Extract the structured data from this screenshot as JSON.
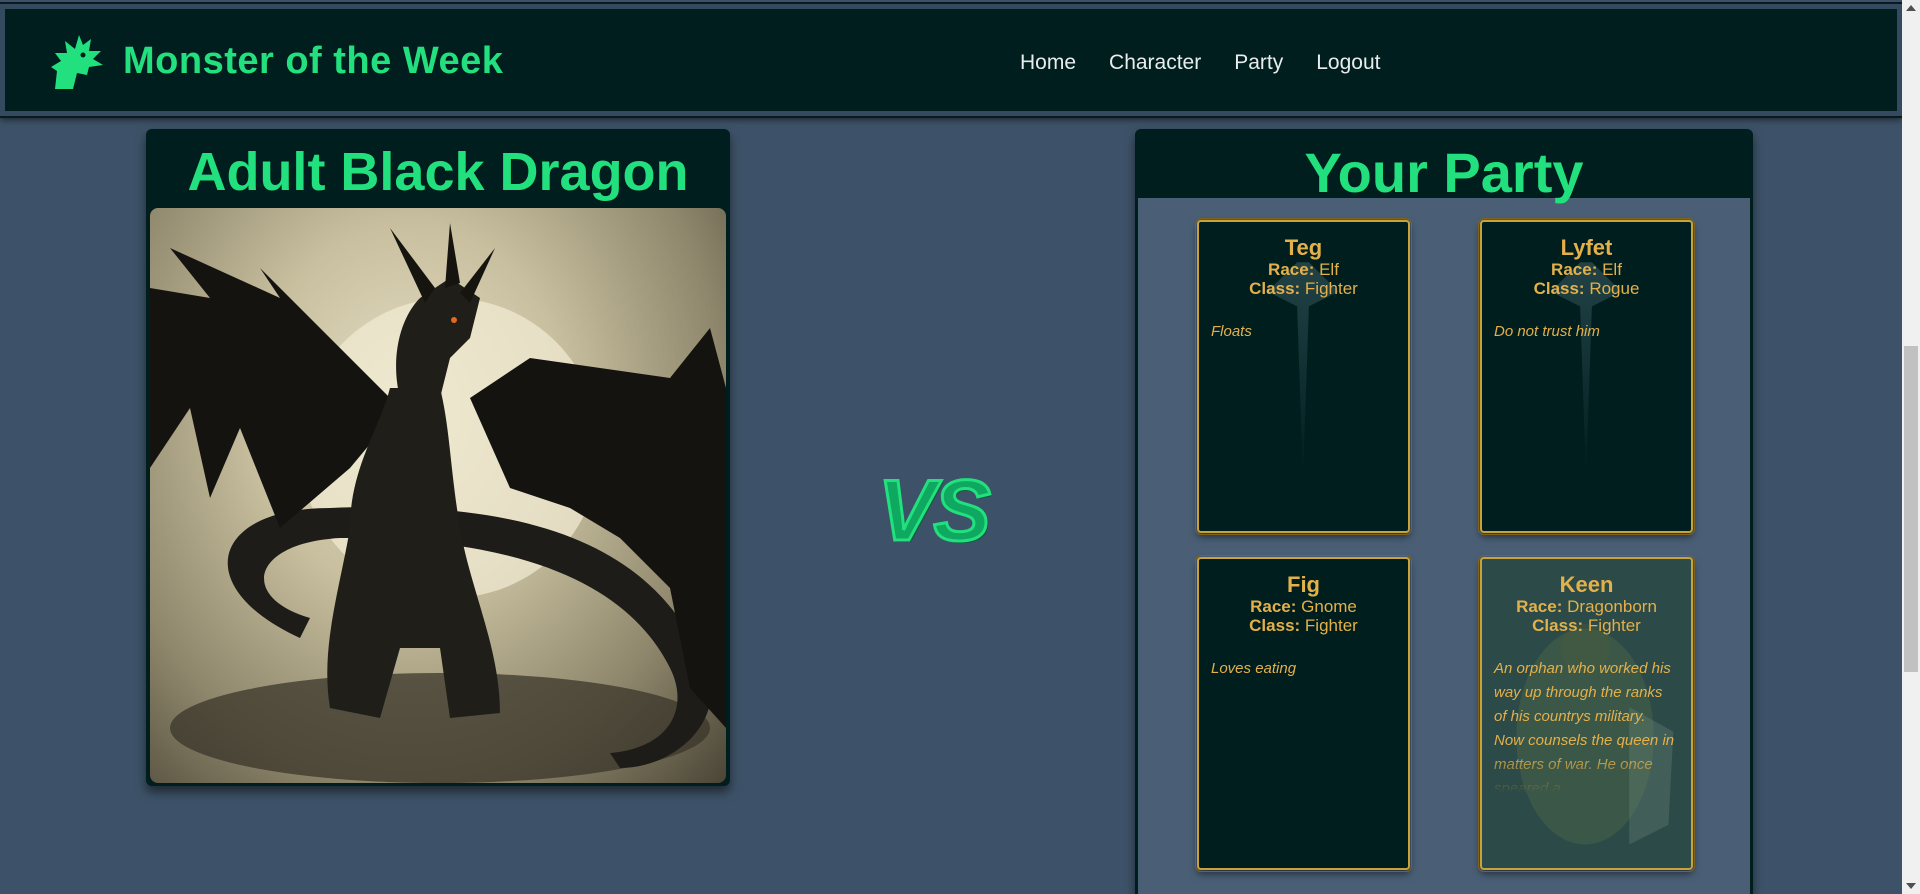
{
  "navbar": {
    "brand": "Monster of the Week",
    "links": [
      "Home",
      "Character",
      "Party",
      "Logout"
    ]
  },
  "monster": {
    "name": "Adult Black Dragon",
    "image_icon": "black-dragon-image"
  },
  "vs_label": "VS",
  "party": {
    "title": "Your Party",
    "race_label": "Race:",
    "class_label": "Class:",
    "characters": [
      {
        "name": "Teg",
        "race": "Elf",
        "class": "Fighter",
        "description": "Floats"
      },
      {
        "name": "Lyfet",
        "race": "Elf",
        "class": "Rogue",
        "description": "Do not trust him"
      },
      {
        "name": "Fig",
        "race": "Gnome",
        "class": "Fighter",
        "description": "Loves eating"
      },
      {
        "name": "Keen",
        "race": "Dragonborn",
        "class": "Fighter",
        "description": "An orphan who worked his way up through the ranks of his countrys military. Now counsels the queen in matters of war. He once speared a"
      }
    ]
  },
  "colors": {
    "accent_green": "#22e07d",
    "card_gold": "#e3b04a",
    "dark_bg": "#001e1e",
    "page_bg": "#3d5268"
  }
}
